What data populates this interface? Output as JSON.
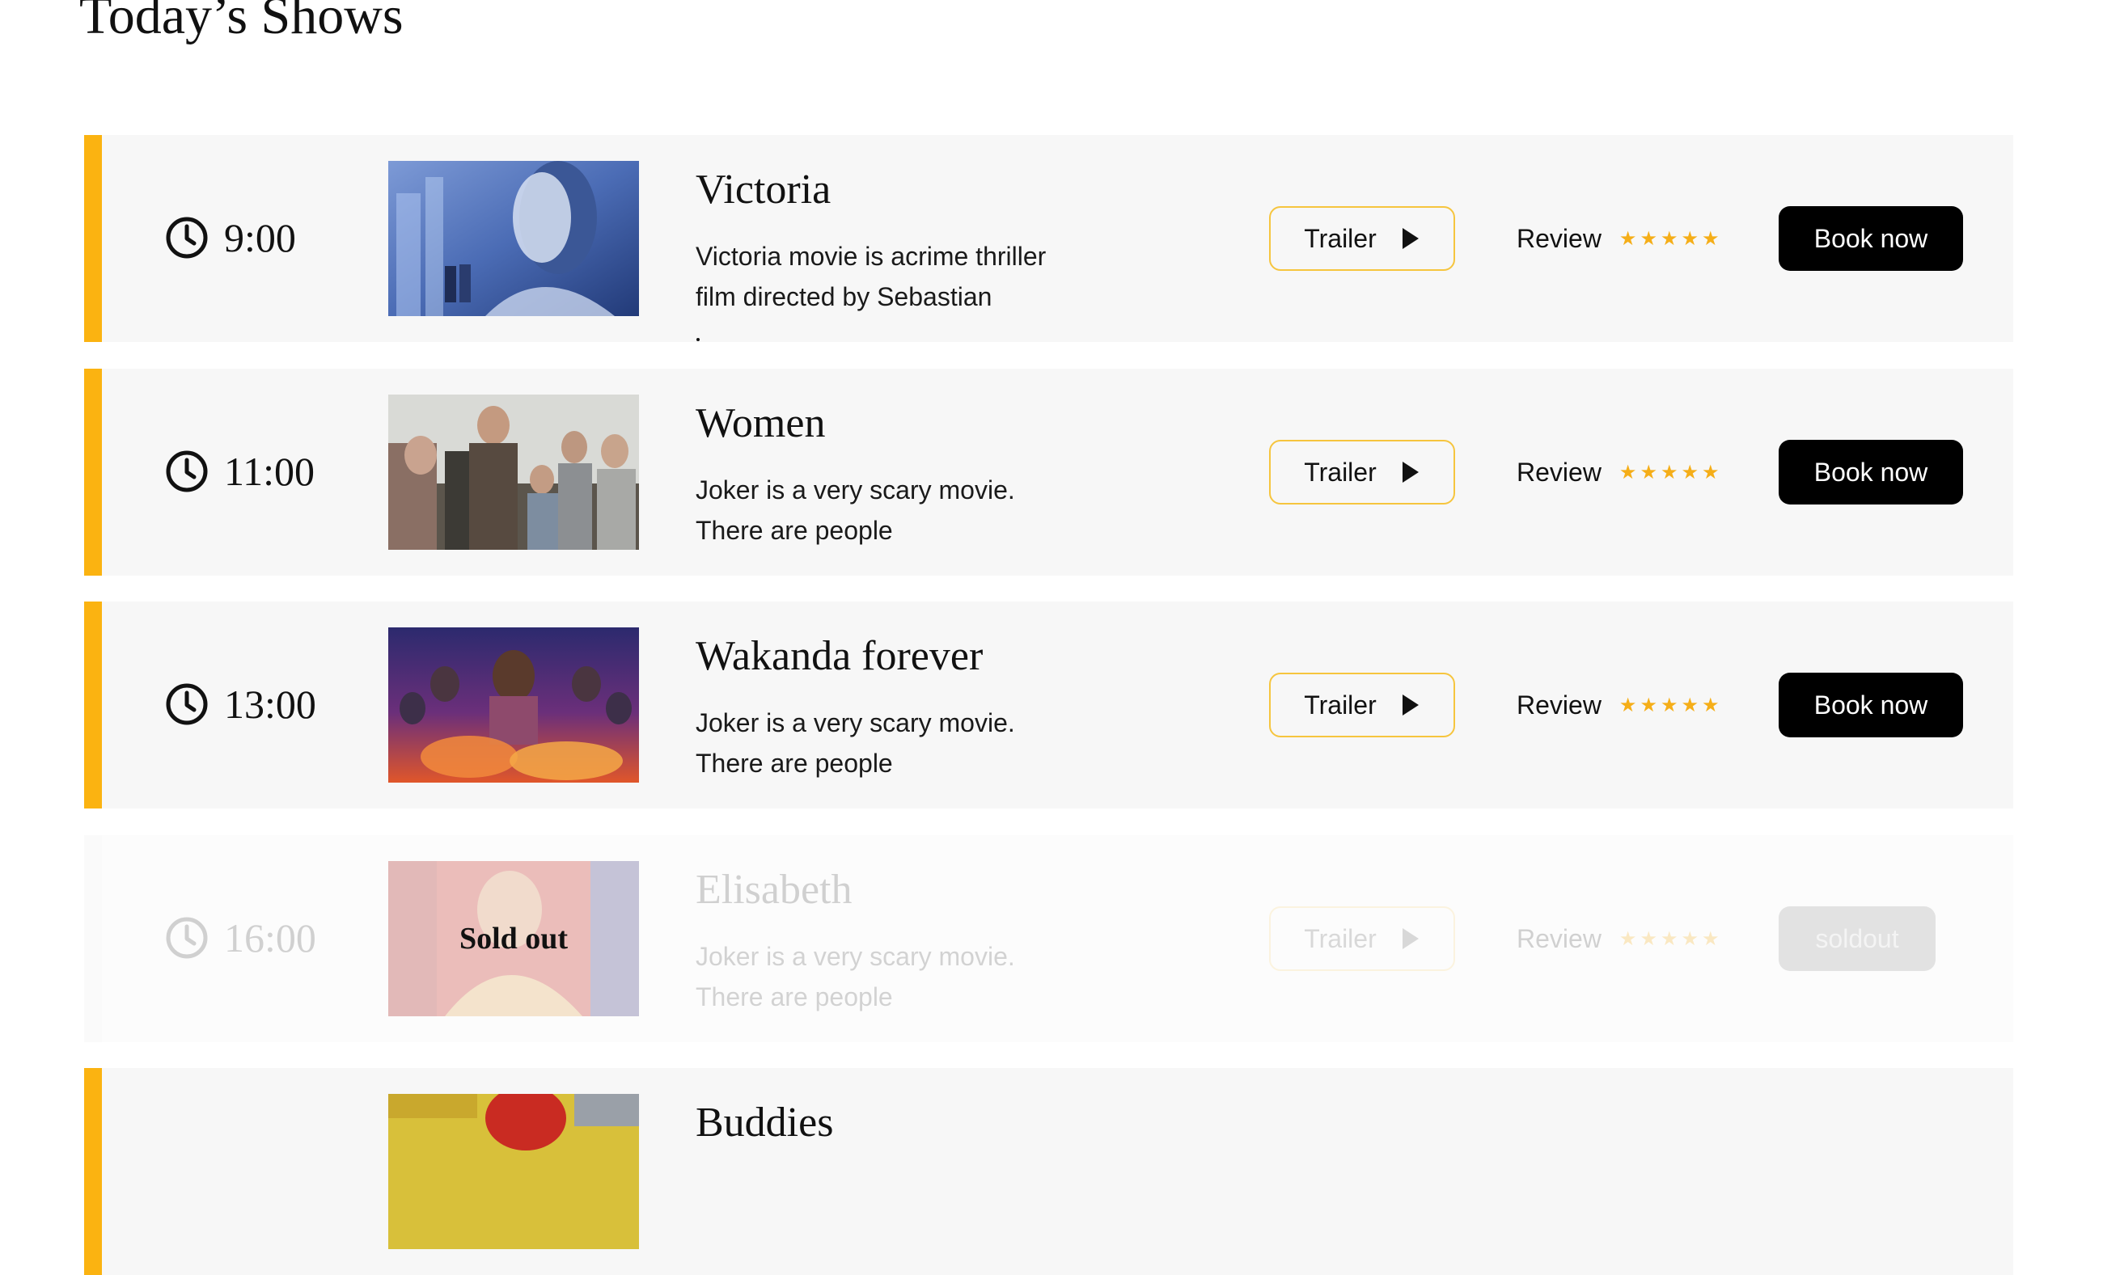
{
  "page": {
    "title": "Today’s Shows"
  },
  "shows": [
    {
      "time": "9:00",
      "title": "Victoria",
      "description": [
        "Victoria movie is acrime thriller",
        "film directed by Sebastian"
      ],
      "trailer_label": "Trailer",
      "review_label": "Review",
      "rating": "★★★★★",
      "book_label": "Book now",
      "poster_icon": "movie-poster-victoria",
      "status": "available"
    },
    {
      "time": "11:00",
      "title": "Women",
      "description": [
        "Joker is a very scary movie.",
        "There are people"
      ],
      "trailer_label": "Trailer",
      "review_label": "Review",
      "rating": "★★★★★",
      "book_label": "Book now",
      "poster_icon": "movie-poster-women",
      "status": "available"
    },
    {
      "time": "13:00",
      "title": "Wakanda forever",
      "description": [
        "Joker is a very scary movie.",
        "There are people"
      ],
      "trailer_label": "Trailer",
      "review_label": "Review",
      "rating": "★★★★★",
      "book_label": "Book now",
      "poster_icon": "movie-poster-wakanda",
      "status": "available"
    },
    {
      "time": "16:00",
      "title": "Elisabeth",
      "description": [
        "Joker is a very scary movie.",
        "There are people"
      ],
      "trailer_label": "Trailer",
      "review_label": "Review",
      "rating": "★★★★★",
      "book_label": "soldout",
      "poster_overlay": "Sold out",
      "poster_icon": "movie-poster-elisabeth",
      "status": "sold-out"
    },
    {
      "time": "",
      "title": "Buddies",
      "poster_icon": "movie-poster-partial",
      "status": "available"
    }
  ],
  "colors": {
    "accent": "#fbb311",
    "star": "#f5ae18",
    "row_background": "#f7f7f7",
    "book_button": "#000000",
    "trailer_border": "#f6c53e"
  }
}
